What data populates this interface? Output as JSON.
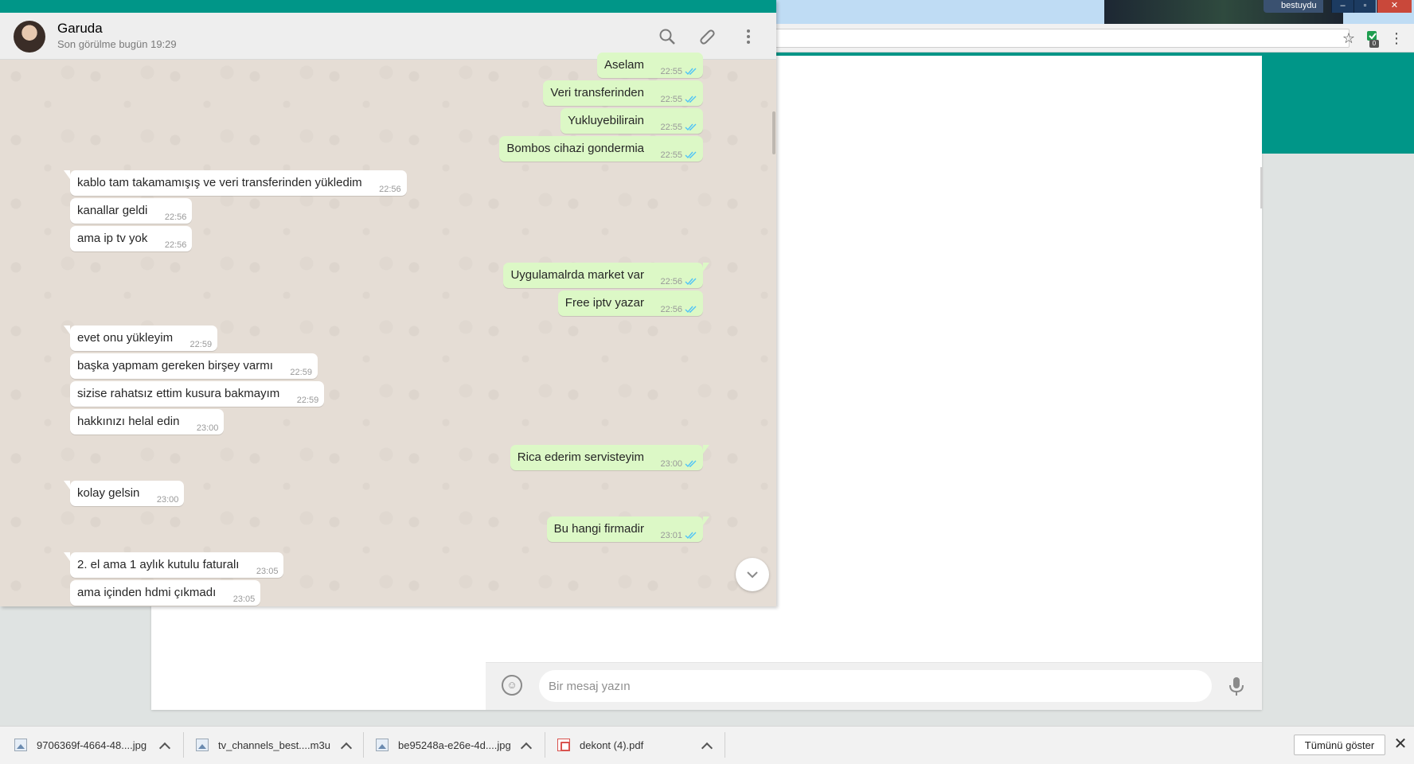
{
  "window": {
    "user_label": "bestuydu",
    "minimize": "–",
    "maximize": "▫",
    "close": "✕"
  },
  "chat": {
    "contact_name": "Garuda",
    "contact_status": "Son görülme bugün 19:29",
    "compose_placeholder": "Bir mesaj yazın",
    "colors": {
      "accent": "#009688",
      "incoming": "#ffffff",
      "outgoing": "#dcf8c6",
      "tick_read": "#4fc3f7"
    },
    "messages": [
      {
        "dir": "out",
        "text": "Aselam",
        "time": "22:55",
        "tail": false
      },
      {
        "dir": "out",
        "text": "Veri transferinden",
        "time": "22:55",
        "tail": false
      },
      {
        "dir": "out",
        "text": "Yukluyebilirain",
        "time": "22:55",
        "tail": false
      },
      {
        "dir": "out",
        "text": "Bombos cihazi gondermia",
        "time": "22:55",
        "tail": false
      },
      {
        "dir": "in",
        "text": "kablo tam takamamışış ve veri transferinden yükledim",
        "time": "22:56",
        "tail": true
      },
      {
        "dir": "in",
        "text": "kanallar geldi",
        "time": "22:56",
        "tail": false
      },
      {
        "dir": "in",
        "text": "ama ip tv yok",
        "time": "22:56",
        "tail": false
      },
      {
        "dir": "out",
        "text": "Uygulamalrda market var",
        "time": "22:56",
        "tail": true
      },
      {
        "dir": "out",
        "text": "Free iptv yazar",
        "time": "22:56",
        "tail": false
      },
      {
        "dir": "in",
        "text": "evet onu yükleyim",
        "time": "22:59",
        "tail": true
      },
      {
        "dir": "in",
        "text": "başka yapmam gereken birşey varmı",
        "time": "22:59",
        "tail": false
      },
      {
        "dir": "in",
        "text": "sizise rahatsız ettim kusura bakmayım",
        "time": "22:59",
        "tail": false
      },
      {
        "dir": "in",
        "text": "hakkınızı helal edin",
        "time": "23:00",
        "tail": false
      },
      {
        "dir": "out",
        "text": "Rica ederim servisteyim",
        "time": "23:00",
        "tail": true
      },
      {
        "dir": "in",
        "text": "kolay gelsin",
        "time": "23:00",
        "tail": true
      },
      {
        "dir": "out",
        "text": "Bu hangi firmadir",
        "time": "23:01",
        "tail": true
      },
      {
        "dir": "in",
        "text": "2. el ama 1 aylık kutulu faturalı",
        "time": "23:05",
        "tail": true
      },
      {
        "dir": "in",
        "text": "ama içinden hdmi çıkmadı",
        "time": "23:05",
        "tail": false
      }
    ]
  },
  "downloads": {
    "items": [
      {
        "name": "9706369f-4664-48....jpg",
        "type": "img"
      },
      {
        "name": "tv_channels_best....m3u",
        "type": "img"
      },
      {
        "name": "be95248a-e26e-4d....jpg",
        "type": "img"
      },
      {
        "name": "dekont (4).pdf",
        "type": "pdf"
      }
    ],
    "show_all": "Tümünü göster",
    "close": "✕"
  },
  "toolbar": {
    "star": "☆",
    "menu": "⋮",
    "ext_badge": "0"
  }
}
